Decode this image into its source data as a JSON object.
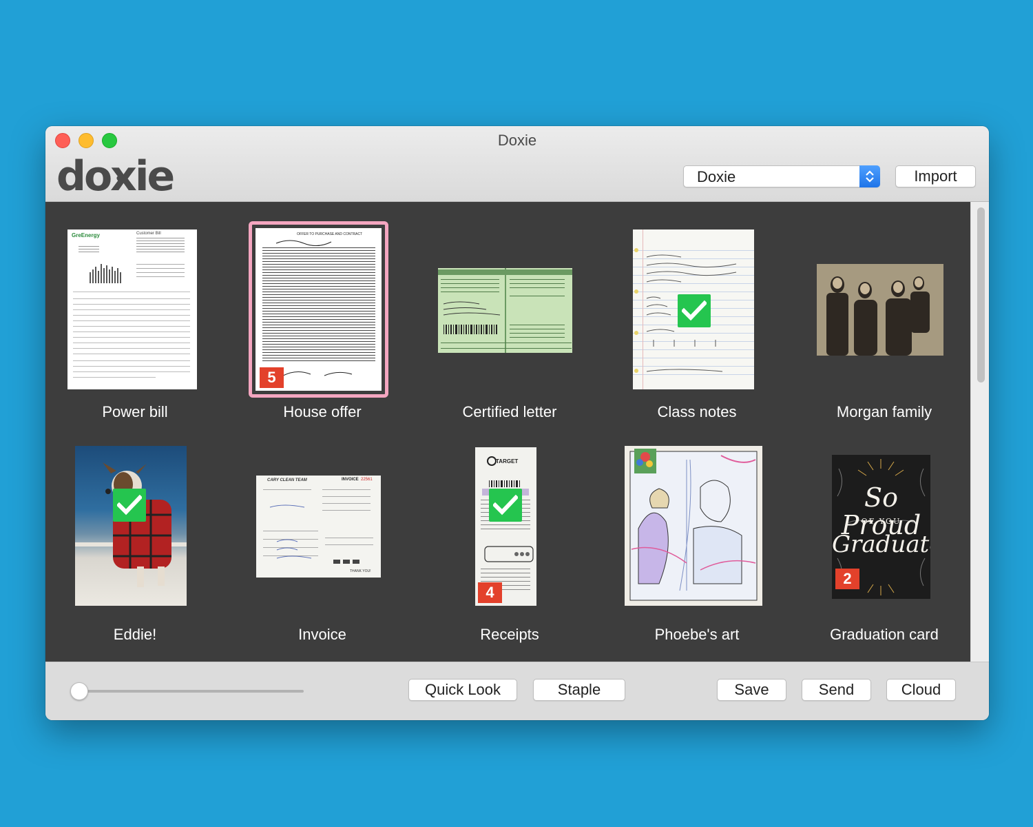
{
  "window": {
    "title": "Doxie"
  },
  "logo": {
    "text": "doxie"
  },
  "toolbar": {
    "device_select": {
      "selected": "Doxie"
    },
    "import_label": "Import"
  },
  "items": [
    {
      "label": "Power bill"
    },
    {
      "label": "House offer",
      "badge": "5",
      "selected": true
    },
    {
      "label": "Certified letter"
    },
    {
      "label": "Class notes",
      "checked": true
    },
    {
      "label": "Morgan family"
    },
    {
      "label": "Eddie!",
      "checked": true
    },
    {
      "label": "Invoice"
    },
    {
      "label": "Receipts",
      "badge": "4",
      "checked": true
    },
    {
      "label": "Phoebe's art"
    },
    {
      "label": "Graduation card",
      "badge": "2"
    }
  ],
  "bottom": {
    "zoom_slider_value": 0,
    "quick_look_label": "Quick Look",
    "staple_label": "Staple",
    "save_label": "Save",
    "send_label": "Send",
    "cloud_label": "Cloud"
  },
  "thumb_text": {
    "power_bill_brand": "GreEnergy",
    "power_bill_heading": "Customer Bill",
    "house_offer_heading": "OFFER TO PURCHASE AND CONTRACT",
    "invoice_company": "CARY CLEAN TEAM",
    "invoice_heading": "INVOICE",
    "invoice_number": "22561",
    "invoice_thanks": "THANK YOU!",
    "receipt_store": "TARGET",
    "grad_line1": "So Proud",
    "grad_line2": "OF YOU",
    "grad_line3": "Graduate"
  },
  "colors": {
    "background": "#21a0d6",
    "content_bg": "#3d3d3d",
    "badge": "#e3412b",
    "check": "#25c54f",
    "selection": "#f4a6c0"
  }
}
